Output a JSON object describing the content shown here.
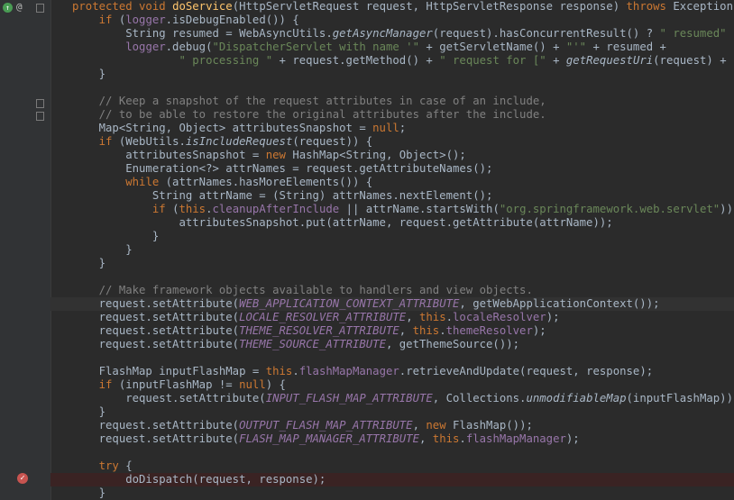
{
  "editor": {
    "lines": [
      [
        [
          "kw",
          "protected void "
        ],
        [
          "mt",
          "doService"
        ],
        [
          "tx",
          "(HttpServletRequest request, HttpServletResponse response) "
        ],
        [
          "kw",
          "throws "
        ],
        [
          "tx",
          "Exception {"
        ]
      ],
      [
        [
          "tx",
          "    "
        ],
        [
          "kw",
          "if "
        ],
        [
          "tx",
          "("
        ],
        [
          "fd",
          "logger"
        ],
        [
          "tx",
          ".isDebugEnabled()) {"
        ]
      ],
      [
        [
          "tx",
          "        String resumed = WebAsyncUtils."
        ],
        [
          "it",
          "getAsyncManager"
        ],
        [
          "tx",
          "(request).hasConcurrentResult() ? "
        ],
        [
          "str",
          "\" resumed\""
        ],
        [
          "tx",
          " : "
        ],
        [
          "str",
          "\"\""
        ],
        [
          "tx",
          ";"
        ]
      ],
      [
        [
          "tx",
          "        "
        ],
        [
          "fd",
          "logger"
        ],
        [
          "tx",
          ".debug("
        ],
        [
          "str",
          "\"DispatcherServlet with name '\""
        ],
        [
          "tx",
          " + getServletName() + "
        ],
        [
          "str",
          "\"'\""
        ],
        [
          "tx",
          " + resumed +"
        ]
      ],
      [
        [
          "tx",
          "                "
        ],
        [
          "str",
          "\" processing \""
        ],
        [
          "tx",
          " + request.getMethod() + "
        ],
        [
          "str",
          "\" request for [\""
        ],
        [
          "tx",
          " + "
        ],
        [
          "it",
          "getRequestUri"
        ],
        [
          "tx",
          "(request) + "
        ],
        [
          "str",
          "\"]\""
        ],
        [
          "tx",
          ");"
        ]
      ],
      [
        [
          "tx",
          "    }"
        ]
      ],
      [],
      [
        [
          "tx",
          "    "
        ],
        [
          "cm",
          "// Keep a snapshot of the request attributes in case of an include,"
        ]
      ],
      [
        [
          "tx",
          "    "
        ],
        [
          "cm",
          "// to be able to restore the original attributes after the include."
        ]
      ],
      [
        [
          "tx",
          "    Map<String, Object> attributesSnapshot = "
        ],
        [
          "kw",
          "null"
        ],
        [
          "tx",
          ";"
        ]
      ],
      [
        [
          "tx",
          "    "
        ],
        [
          "kw",
          "if "
        ],
        [
          "tx",
          "(WebUtils."
        ],
        [
          "it",
          "isIncludeRequest"
        ],
        [
          "tx",
          "(request)) {"
        ]
      ],
      [
        [
          "tx",
          "        attributesSnapshot = "
        ],
        [
          "kw",
          "new "
        ],
        [
          "tx",
          "HashMap<String, Object>();"
        ]
      ],
      [
        [
          "tx",
          "        Enumeration<?> attrNames = request.getAttributeNames();"
        ]
      ],
      [
        [
          "tx",
          "        "
        ],
        [
          "kw",
          "while "
        ],
        [
          "tx",
          "(attrNames.hasMoreElements()) {"
        ]
      ],
      [
        [
          "tx",
          "            String attrName = (String) attrNames.nextElement();"
        ]
      ],
      [
        [
          "tx",
          "            "
        ],
        [
          "kw",
          "if "
        ],
        [
          "tx",
          "("
        ],
        [
          "kw",
          "this"
        ],
        [
          "tx",
          "."
        ],
        [
          "fd",
          "cleanupAfterInclude"
        ],
        [
          "tx",
          " || attrName.startsWith("
        ],
        [
          "str",
          "\"org.springframework.web.servlet\""
        ],
        [
          "tx",
          ")) {"
        ]
      ],
      [
        [
          "tx",
          "                attributesSnapshot.put(attrName, request.getAttribute(attrName));"
        ]
      ],
      [
        [
          "tx",
          "            }"
        ]
      ],
      [
        [
          "tx",
          "        }"
        ]
      ],
      [
        [
          "tx",
          "    }"
        ]
      ],
      [],
      [
        [
          "tx",
          "    "
        ],
        [
          "cm",
          "// Make framework objects available to handlers and view objects."
        ]
      ],
      [
        [
          "tx",
          "    request.setAttribute("
        ],
        [
          "cn",
          "WEB_APPLICATION_CONTEXT_ATTRIBUTE"
        ],
        [
          "tx",
          ", getWebApplicationContext());"
        ]
      ],
      [
        [
          "tx",
          "    request.setAttribute("
        ],
        [
          "cn",
          "LOCALE_RESOLVER_ATTRIBUTE"
        ],
        [
          "tx",
          ", "
        ],
        [
          "kw",
          "this"
        ],
        [
          "tx",
          "."
        ],
        [
          "fd",
          "localeResolver"
        ],
        [
          "tx",
          ");"
        ]
      ],
      [
        [
          "tx",
          "    request.setAttribute("
        ],
        [
          "cn",
          "THEME_RESOLVER_ATTRIBUTE"
        ],
        [
          "tx",
          ", "
        ],
        [
          "kw",
          "this"
        ],
        [
          "tx",
          "."
        ],
        [
          "fd",
          "themeResolver"
        ],
        [
          "tx",
          ");"
        ]
      ],
      [
        [
          "tx",
          "    request.setAttribute("
        ],
        [
          "cn",
          "THEME_SOURCE_ATTRIBUTE"
        ],
        [
          "tx",
          ", getThemeSource());"
        ]
      ],
      [],
      [
        [
          "tx",
          "    FlashMap inputFlashMap = "
        ],
        [
          "kw",
          "this"
        ],
        [
          "tx",
          "."
        ],
        [
          "fd",
          "flashMapManager"
        ],
        [
          "tx",
          ".retrieveAndUpdate(request, response);"
        ]
      ],
      [
        [
          "tx",
          "    "
        ],
        [
          "kw",
          "if "
        ],
        [
          "tx",
          "(inputFlashMap != "
        ],
        [
          "kw",
          "null"
        ],
        [
          "tx",
          ") {"
        ]
      ],
      [
        [
          "tx",
          "        request.setAttribute("
        ],
        [
          "cn",
          "INPUT_FLASH_MAP_ATTRIBUTE"
        ],
        [
          "tx",
          ", Collections."
        ],
        [
          "it",
          "unmodifiableMap"
        ],
        [
          "tx",
          "(inputFlashMap));"
        ]
      ],
      [
        [
          "tx",
          "    }"
        ]
      ],
      [
        [
          "tx",
          "    request.setAttribute("
        ],
        [
          "cn",
          "OUTPUT_FLASH_MAP_ATTRIBUTE"
        ],
        [
          "tx",
          ", "
        ],
        [
          "kw",
          "new "
        ],
        [
          "tx",
          "FlashMap());"
        ]
      ],
      [
        [
          "tx",
          "    request.setAttribute("
        ],
        [
          "cn",
          "FLASH_MAP_MANAGER_ATTRIBUTE"
        ],
        [
          "tx",
          ", "
        ],
        [
          "kw",
          "this"
        ],
        [
          "tx",
          "."
        ],
        [
          "fd",
          "flashMapManager"
        ],
        [
          "tx",
          ");"
        ]
      ],
      [],
      [
        [
          "tx",
          "    "
        ],
        [
          "kw",
          "try "
        ],
        [
          "tx",
          "{"
        ]
      ],
      [
        [
          "tx",
          "        doDispatch(request, response);"
        ]
      ],
      [
        [
          "tx",
          "    }"
        ]
      ]
    ],
    "highlight_line": 22,
    "breakpoint_line": 35,
    "colors": {
      "background": "#2b2b2b",
      "keyword": "#cc7832",
      "string": "#6a8759",
      "comment": "#808080",
      "field": "#9876aa",
      "method": "#ffc66d",
      "text": "#a9b7c6"
    },
    "gutter_icons": {
      "override": "override-up-icon",
      "annotation": "annotation-icon",
      "fold": "fold-marker-icon",
      "breakpoint": "breakpoint-icon"
    }
  }
}
